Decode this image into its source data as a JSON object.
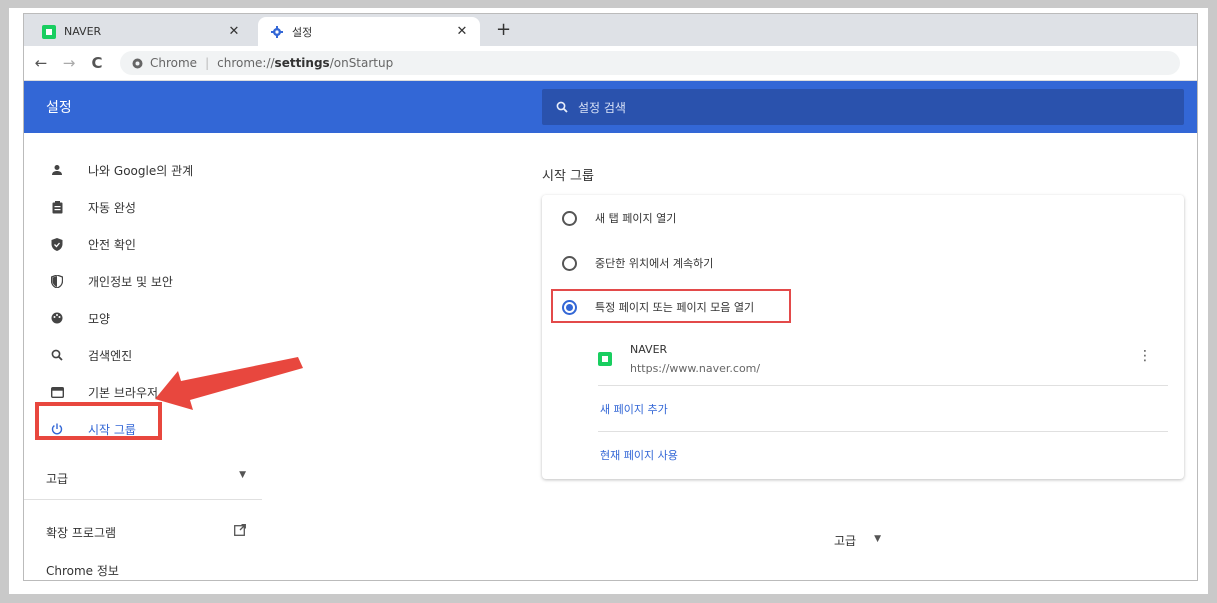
{
  "tabs": [
    {
      "label": "NAVER",
      "close": "✕"
    },
    {
      "label": "설정",
      "close": "✕"
    }
  ],
  "new_tab": "+",
  "toolbar": {
    "back": "←",
    "forward": "→",
    "reload": "C",
    "site_label": "Chrome",
    "url_prefix": "chrome://",
    "url_bold": "settings",
    "url_suffix": "/onStartup"
  },
  "header": {
    "title": "설정",
    "search_placeholder": "설정 검색"
  },
  "sidebar": {
    "items": [
      {
        "label": "나와 Google의 관계",
        "icon": "person-icon"
      },
      {
        "label": "자동 완성",
        "icon": "clipboard-icon"
      },
      {
        "label": "안전 확인",
        "icon": "shield-icon"
      },
      {
        "label": "개인정보 및 보안",
        "icon": "privacy-shield-icon"
      },
      {
        "label": "모양",
        "icon": "palette-icon"
      },
      {
        "label": "검색엔진",
        "icon": "search-icon"
      },
      {
        "label": "기본 브라우저",
        "icon": "browser-icon"
      },
      {
        "label": "시작 그룹",
        "icon": "power-icon"
      }
    ],
    "advanced": "고급",
    "extensions": "확장 프로그램",
    "about": "Chrome 정보"
  },
  "main": {
    "section_title": "시작 그룹",
    "options": [
      {
        "label": "새 탭 페이지 열기",
        "checked": false
      },
      {
        "label": "중단한 위치에서 계속하기",
        "checked": false
      },
      {
        "label": "특정 페이지 또는 페이지 모음 열기",
        "checked": true
      }
    ],
    "site": {
      "name": "NAVER",
      "url": "https://www.naver.com/"
    },
    "add_page": "새 페이지 추가",
    "use_current": "현재 페이지 사용",
    "advanced": "고급"
  },
  "colors": {
    "accent": "#3367d6",
    "header_bg": "#3367d6",
    "annotation_red": "#e8473e",
    "naver_green": "#19ce60"
  }
}
